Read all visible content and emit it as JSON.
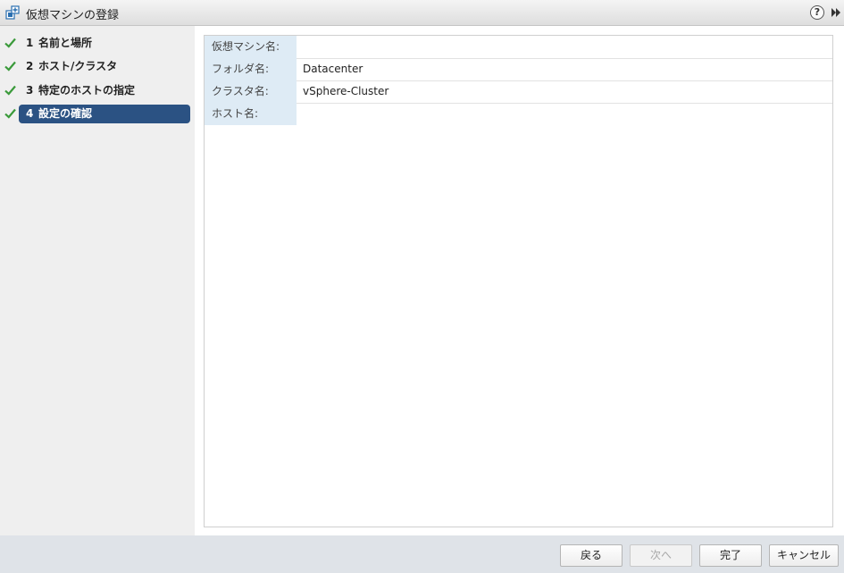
{
  "window": {
    "title": "仮想マシンの登録",
    "title_icon": "vm-register-icon",
    "help_label": "?"
  },
  "steps": [
    {
      "num": "1",
      "label": "名前と場所",
      "completed": true,
      "active": false
    },
    {
      "num": "2",
      "label": "ホスト/クラスタ",
      "completed": true,
      "active": false
    },
    {
      "num": "3",
      "label": "特定のホストの指定",
      "completed": true,
      "active": false
    },
    {
      "num": "4",
      "label": "設定の確認",
      "completed": true,
      "active": true
    }
  ],
  "summary": [
    {
      "label": "仮想マシン名:",
      "value": ""
    },
    {
      "label": "フォルダ名:",
      "value": "Datacenter"
    },
    {
      "label": "クラスタ名:",
      "value": "vSphere-Cluster"
    },
    {
      "label": "ホスト名:",
      "value": ""
    }
  ],
  "buttons": {
    "back": "戻る",
    "next": "次へ",
    "finish": "完了",
    "cancel": "キャンセル"
  },
  "colors": {
    "active_step": "#2b5283",
    "check": "#3a9a3a",
    "label_bg": "#deebf5"
  }
}
